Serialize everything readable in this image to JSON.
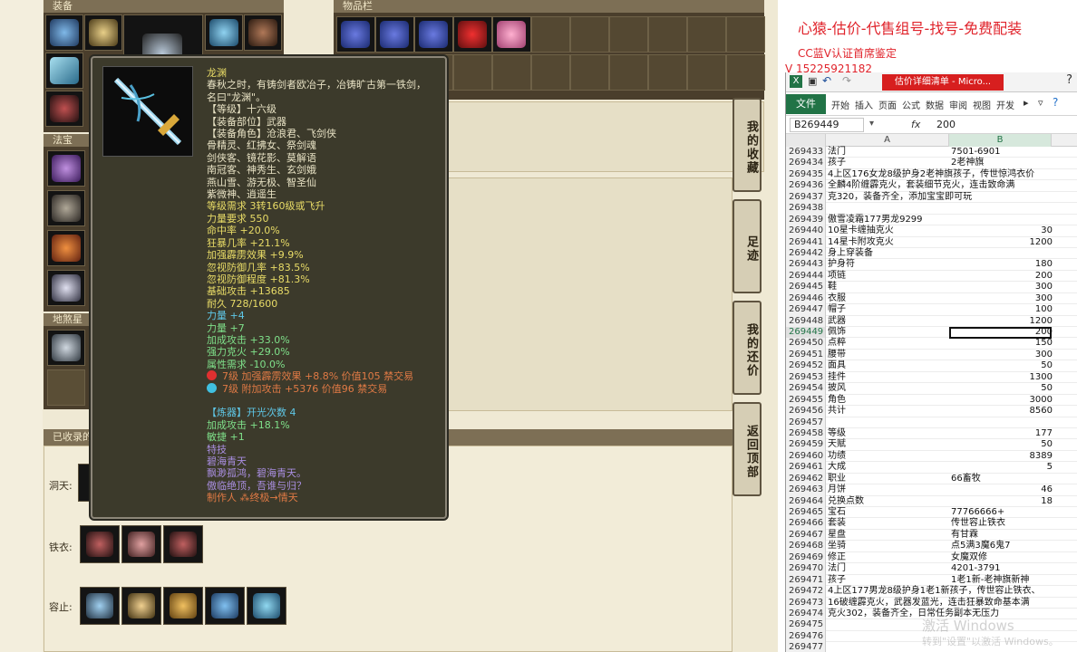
{
  "game": {
    "equip_header": "装备",
    "bag_header": "物品栏",
    "magic_header": "法宝",
    "earth_header": "地煞星阵",
    "collected_header": "已收录的",
    "rows": [
      {
        "label": "洞天:"
      },
      {
        "label": "铁衣:"
      },
      {
        "label": "容止:"
      }
    ],
    "side_buttons": [
      "我的收藏",
      "足迹",
      "我的还价",
      "返回顶部"
    ]
  },
  "tooltip": {
    "name": "龙渊",
    "desc_1": "春秋之时，有铸剑者欧冶子，冶铸旷古第一铁剑，",
    "desc_2": "名曰\"龙渊\"。",
    "level": "【等级】十六级",
    "slot": "【装备部位】武器",
    "roles_1": "【装备角色】沧浪君、飞剑侠",
    "roles_2": "骨精灵、红拂女、祭剑魂",
    "roles_3": "剑侠客、镜花影、莫解语",
    "roles_4": "南冠客、神秀生、玄剑娥",
    "roles_5": "燕山雪、游无极、智圣仙",
    "roles_6": "紫微神、逍遥生",
    "req_level": "等级需求 3转160级或飞升",
    "req_str": "力量要求 550",
    "hit": "命中率 +20.0%",
    "crit": "狂暴几率 +21.1%",
    "thunder": "加强霹雳效果 +9.9%",
    "ignore_def_rate": "忽视防御几率 +83.5%",
    "ignore_def": "忽视防御程度 +81.3%",
    "base_atk": "基础攻击 +13685",
    "durability": "耐久 728/1600",
    "str1": "力量 +4",
    "str2": "力量 +7",
    "atk_bonus": "加成攻击 +33.0%",
    "strong_hit": "强力克火 +29.0%",
    "attr_req": "属性需求 -10.0%",
    "gem1": "7级 加强霹雳效果 +8.8% 价值105 禁交易",
    "gem2": "7级 附加攻击 +5376 价值96 禁交易",
    "refine_title": "【炼器】开光次数 4",
    "refine_atk": "加成攻击 +18.1%",
    "refine_agi": "敏捷 +1",
    "special": "特技",
    "poem_1": "碧海青天",
    "poem_2": "飘渺孤鸿，碧海青天。",
    "poem_3": "傲临绝顶，吾谁与归？",
    "maker": "制作人 ⁂终极→情天"
  },
  "ads": {
    "line1": "心猿-估价-代售组号-找号-免费配装",
    "line2": "CC蓝V认证首席鉴定",
    "line3": "V 15225921182"
  },
  "excel": {
    "doc_title": "估价详细清单 - Micro...",
    "help": "?",
    "file_tab": "文件",
    "tabs": [
      "开始",
      "插入",
      "页面",
      "公式",
      "数据",
      "审阅",
      "视图",
      "开发"
    ],
    "name_box": "B269449",
    "fx": "fx",
    "formula_value": "200",
    "col_a": "A",
    "col_b": "B",
    "rows": [
      {
        "n": "269433",
        "a": "法门",
        "b": "7501-6901",
        "num": false
      },
      {
        "n": "269434",
        "a": "孩子",
        "b": "2老神旗",
        "num": false
      },
      {
        "n": "269435",
        "a": "4上区176女龙8级护身2老神旗孩子，传世惊鸿衣价",
        "b": "",
        "num": false
      },
      {
        "n": "269436",
        "a": "全麟4阶缠霹克火，套装细节克火，连击致命满",
        "b": "",
        "num": false
      },
      {
        "n": "269437",
        "a": "克320，装备齐全，添加宝宝即可玩",
        "b": "",
        "num": false
      },
      {
        "n": "269438",
        "a": "",
        "b": "",
        "num": false
      },
      {
        "n": "269439",
        "a": "傲雪凌霜177男龙9299",
        "b": "",
        "num": false
      },
      {
        "n": "269440",
        "a": "10星卡缠抽克火",
        "b": "30",
        "num": true
      },
      {
        "n": "269441",
        "a": "14星卡附攻克火",
        "b": "1200",
        "num": true
      },
      {
        "n": "269442",
        "a": "身上穿装备",
        "b": "",
        "num": false
      },
      {
        "n": "269443",
        "a": "护身符",
        "b": "180",
        "num": true
      },
      {
        "n": "269444",
        "a": "项链",
        "b": "200",
        "num": true
      },
      {
        "n": "269445",
        "a": "鞋",
        "b": "300",
        "num": true
      },
      {
        "n": "269446",
        "a": "衣服",
        "b": "300",
        "num": true
      },
      {
        "n": "269447",
        "a": "帽子",
        "b": "100",
        "num": true
      },
      {
        "n": "269448",
        "a": "武器",
        "b": "1200",
        "num": true
      },
      {
        "n": "269449",
        "a": "佩饰",
        "b": "200",
        "num": true,
        "sel": true
      },
      {
        "n": "269450",
        "a": "点粹",
        "b": "150",
        "num": true
      },
      {
        "n": "269451",
        "a": "腰带",
        "b": "300",
        "num": true
      },
      {
        "n": "269452",
        "a": "面具",
        "b": "50",
        "num": true
      },
      {
        "n": "269453",
        "a": "挂件",
        "b": "1300",
        "num": true
      },
      {
        "n": "269454",
        "a": "披风",
        "b": "50",
        "num": true
      },
      {
        "n": "269455",
        "a": "角色",
        "b": "3000",
        "num": true
      },
      {
        "n": "269456",
        "a": "共计",
        "b": "8560",
        "num": true
      },
      {
        "n": "269457",
        "a": "",
        "b": "",
        "num": false
      },
      {
        "n": "269458",
        "a": "等级",
        "b": "177",
        "num": true
      },
      {
        "n": "269459",
        "a": "天赋",
        "b": "50",
        "num": true
      },
      {
        "n": "269460",
        "a": "功绩",
        "b": "8389",
        "num": true
      },
      {
        "n": "269461",
        "a": "大成",
        "b": "5",
        "num": true
      },
      {
        "n": "269462",
        "a": "职业",
        "b": "66畜牧",
        "num": false
      },
      {
        "n": "269463",
        "a": "月饼",
        "b": "46",
        "num": true
      },
      {
        "n": "269464",
        "a": "兑换点数",
        "b": "18",
        "num": true
      },
      {
        "n": "269465",
        "a": "宝石",
        "b": "77766666+",
        "num": false
      },
      {
        "n": "269466",
        "a": "套装",
        "b": "传世容止铁衣",
        "num": false
      },
      {
        "n": "269467",
        "a": "星盘",
        "b": "有甘霖",
        "num": false
      },
      {
        "n": "269468",
        "a": "坐骑",
        "b": "点5满3魔6鬼7",
        "num": false
      },
      {
        "n": "269469",
        "a": "修正",
        "b": "女魔双修",
        "num": false
      },
      {
        "n": "269470",
        "a": "法门",
        "b": "4201-3791",
        "num": false
      },
      {
        "n": "269471",
        "a": "孩子",
        "b": "1老1新-老神旗新神",
        "num": false
      },
      {
        "n": "269472",
        "a": "4上区177男龙8级护身1老1新孩子，传世容止铁衣、",
        "b": "",
        "num": false
      },
      {
        "n": "269473",
        "a": "16破缠霹克火，武器发蓝光，连击狂暴致命基本满",
        "b": "",
        "num": false
      },
      {
        "n": "269474",
        "a": "克火302，装备齐全，日常任务副本无压力",
        "b": "",
        "num": false
      },
      {
        "n": "269475",
        "a": "",
        "b": "",
        "num": false
      },
      {
        "n": "269476",
        "a": "",
        "b": "",
        "num": false
      },
      {
        "n": "269477",
        "a": "",
        "b": "",
        "num": false
      }
    ],
    "watermark_1": "激活 Windows",
    "watermark_2": "转到\"设置\"以激活 Windows。"
  }
}
